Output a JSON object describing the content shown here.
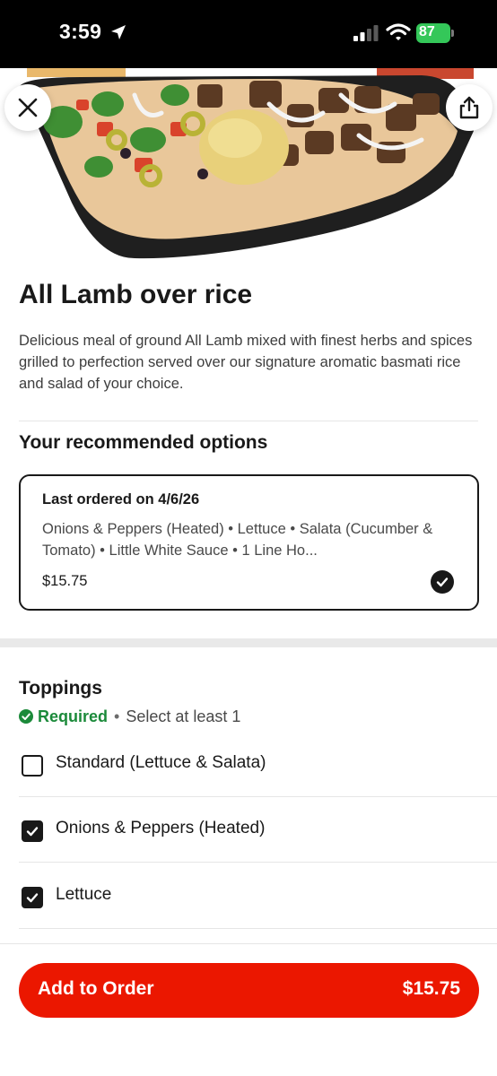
{
  "status_bar": {
    "time": "3:59",
    "battery": "87"
  },
  "item": {
    "title": "All Lamb over rice",
    "description": "Delicious meal of ground All Lamb mixed with finest herbs and spices grilled to perfection served over our signature aromatic basmati rice and salad of your choice."
  },
  "recommended": {
    "section_title": "Your recommended options",
    "card": {
      "header": "Last ordered on 4/6/26",
      "items": "Onions & Peppers (Heated) • Lettuce • Salata (Cucumber & Tomato) • Little White Sauce • 1 Line Ho...",
      "price": "$15.75",
      "selected": true
    }
  },
  "toppings": {
    "section_title": "Toppings",
    "required_label": "Required",
    "separator": "•",
    "hint": "Select at least 1",
    "options": [
      {
        "label": "Standard (Lettuce & Salata)",
        "checked": false
      },
      {
        "label": "Onions & Peppers (Heated)",
        "checked": true
      },
      {
        "label": "Lettuce",
        "checked": true
      }
    ]
  },
  "cta": {
    "label": "Add to Order",
    "price": "$15.75"
  },
  "colors": {
    "brand_red": "#eb1700",
    "required_green": "#1b8a3a",
    "battery_green": "#34c759"
  },
  "icons": [
    "location-arrow-icon",
    "cellular-signal-icon",
    "wifi-icon",
    "battery-icon",
    "close-icon",
    "share-icon",
    "checkmark-circle-icon",
    "required-check-icon",
    "checkbox-icon"
  ]
}
